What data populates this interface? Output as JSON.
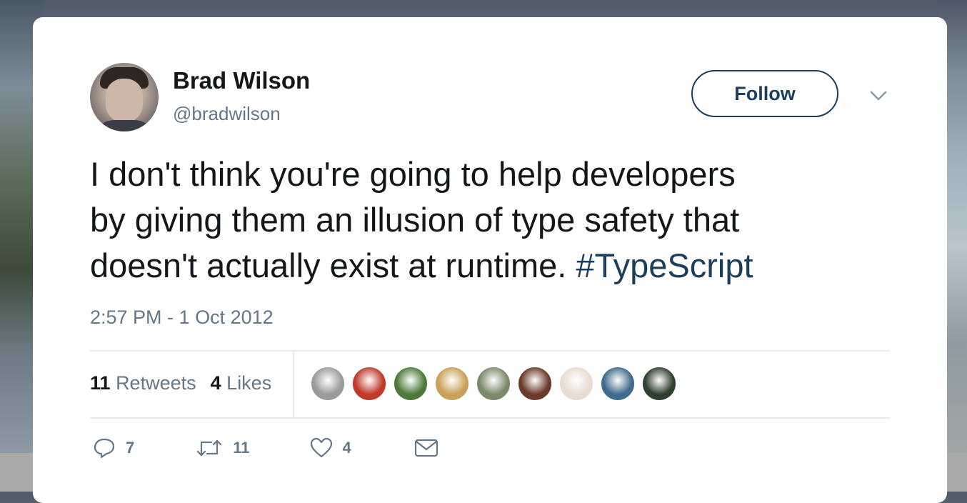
{
  "author": {
    "name": "Brad Wilson",
    "handle": "@bradwilson"
  },
  "follow_button": {
    "label": "Follow"
  },
  "tweet": {
    "line1": "I don't think you're going to help developers",
    "line2": "by giving them an illusion of type safety that",
    "line3_text": "doesn't actually exist at runtime. ",
    "hashtag": "#TypeScript",
    "timestamp": "2:57 PM - 1 Oct 2012"
  },
  "stats": {
    "retweets_count": "11",
    "retweets_label": "Retweets",
    "likes_count": "4",
    "likes_label": "Likes"
  },
  "actions": {
    "reply_count": "7",
    "retweet_count": "11",
    "like_count": "4"
  },
  "likers": [
    {
      "color": "#9a9a9a"
    },
    {
      "color": "#c0392b"
    },
    {
      "color": "#4d7a3a"
    },
    {
      "color": "#c9a05a"
    },
    {
      "color": "#7a8a6a"
    },
    {
      "color": "#6b3a2a"
    },
    {
      "color": "#e8dcd0"
    },
    {
      "color": "#3f6b8c"
    },
    {
      "color": "#2f3f2f"
    }
  ],
  "colors": {
    "brand": "#1b3e5c",
    "text": "#14171a",
    "secondary": "#657786"
  },
  "icons": [
    "chevron-down-icon",
    "reply-icon",
    "retweet-icon",
    "heart-icon",
    "envelope-icon"
  ]
}
